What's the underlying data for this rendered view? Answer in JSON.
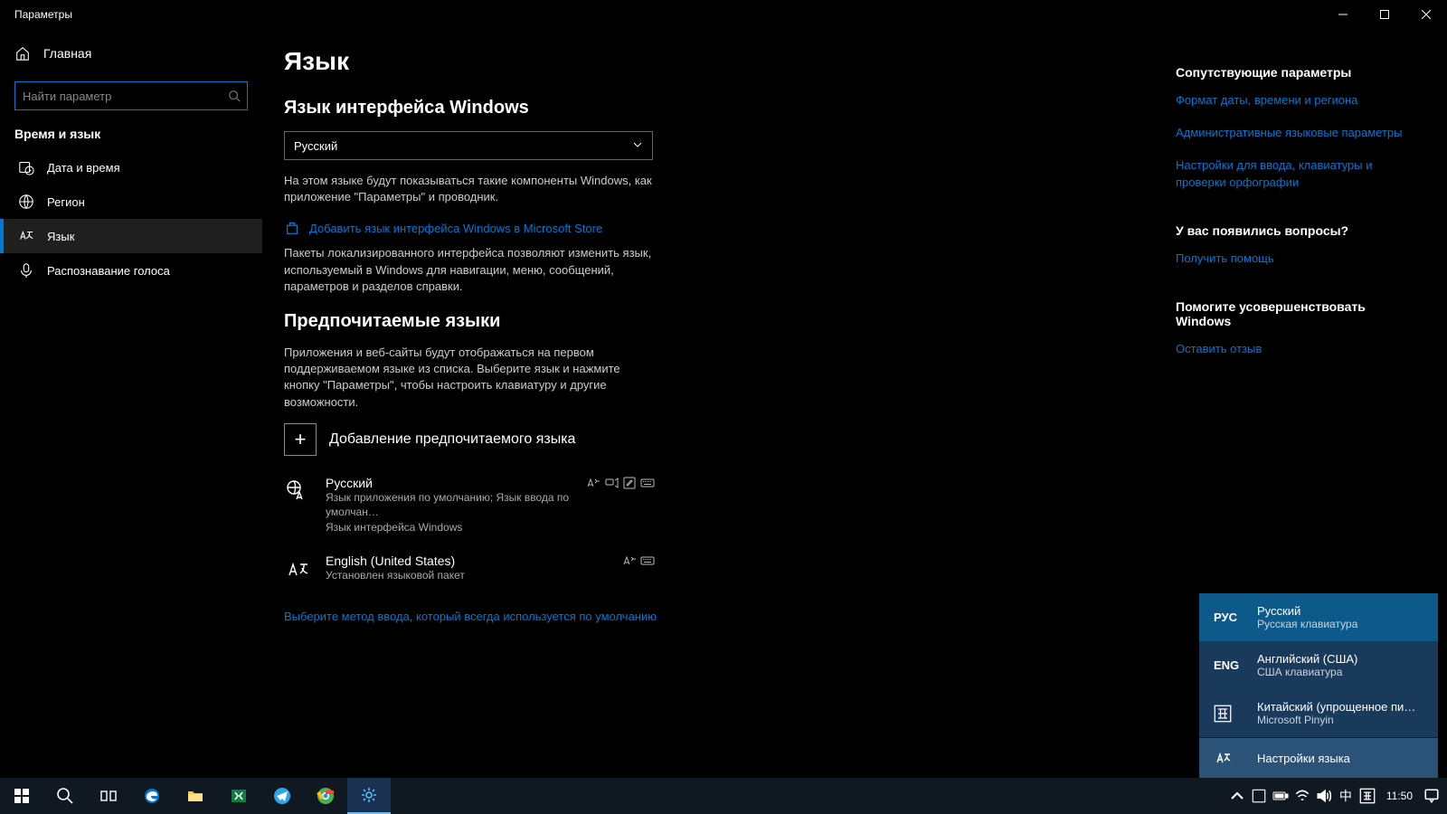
{
  "window": {
    "title": "Параметры"
  },
  "sidebar": {
    "home": "Главная",
    "search_placeholder": "Найти параметр",
    "section": "Время и язык",
    "items": [
      {
        "label": "Дата и время"
      },
      {
        "label": "Регион"
      },
      {
        "label": "Язык"
      },
      {
        "label": "Распознавание голоса"
      }
    ]
  },
  "page": {
    "title": "Язык",
    "display_lang_header": "Язык интерфейса Windows",
    "display_lang_value": "Русский",
    "display_lang_desc": "На этом языке будут показываться такие компоненты Windows, как приложение \"Параметры\" и проводник.",
    "store_link": "Добавить язык интерфейса Windows в Microsoft Store",
    "store_desc": "Пакеты локализированного интерфейса позволяют изменить язык, используемый в Windows для навигации, меню, сообщений, параметров и разделов справки.",
    "preferred_header": "Предпочитаемые языки",
    "preferred_desc": "Приложения и веб-сайты будут отображаться на первом поддерживаемом языке из списка. Выберите язык и нажмите кнопку \"Параметры\", чтобы настроить клавиатуру и другие возможности.",
    "add_lang": "Добавление предпочитаемого языка",
    "langs": [
      {
        "name": "Русский",
        "desc1": "Язык приложения по умолчанию; Язык ввода по умолчан…",
        "desc2": "Язык интерфейса Windows",
        "features": 4
      },
      {
        "name": "English (United States)",
        "desc1": "Установлен языковой пакет",
        "desc2": "",
        "features": 2
      }
    ],
    "default_input_link": "Выберите метод ввода, который всегда используется по умолчанию"
  },
  "related": {
    "header1": "Сопутствующие параметры",
    "links1": [
      "Формат даты, времени и региона",
      "Административные языковые параметры",
      "Настройки для ввода, клавиатуры и проверки орфографии"
    ],
    "header2": "У вас появились вопросы?",
    "help_link": "Получить помощь",
    "header3": "Помогите усовершенствовать Windows",
    "feedback_link": "Оставить отзыв"
  },
  "ime": {
    "items": [
      {
        "abbrev": "РУС",
        "name": "Русский",
        "sub": "Русская клавиатура"
      },
      {
        "abbrev": "ENG",
        "name": "Английский (США)",
        "sub": "США клавиатура"
      },
      {
        "abbrev": "",
        "name": "Китайский (упрощенное пи…",
        "sub": "Microsoft Pinyin"
      }
    ],
    "settings": "Настройки языка"
  },
  "taskbar": {
    "ime_indicator": "中",
    "time": "11:50"
  }
}
